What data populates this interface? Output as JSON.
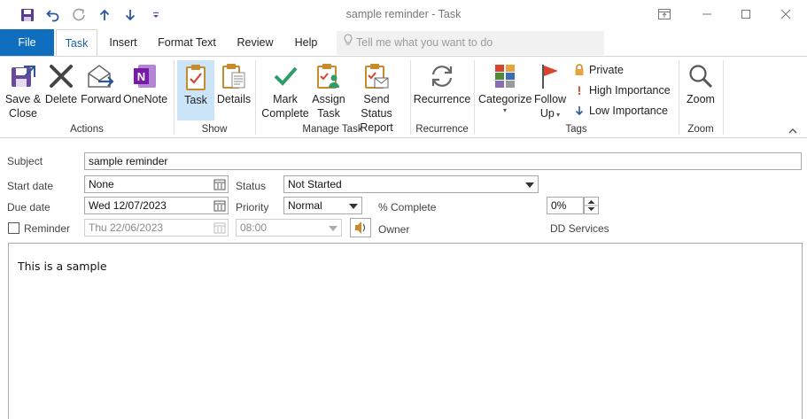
{
  "window": {
    "title": "sample reminder  -  Task"
  },
  "tabs": [
    {
      "label": "File"
    },
    {
      "label": "Task"
    },
    {
      "label": "Insert"
    },
    {
      "label": "Format Text"
    },
    {
      "label": "Review"
    },
    {
      "label": "Help"
    }
  ],
  "tellme": {
    "placeholder": "Tell me what you want to do"
  },
  "ribbon": {
    "actions": {
      "label": "Actions",
      "save_close": [
        "Save &",
        "Close"
      ],
      "delete": "Delete",
      "forward": "Forward",
      "onenote": "OneNote"
    },
    "show": {
      "label": "Show",
      "task": "Task",
      "details": "Details"
    },
    "manage": {
      "label": "Manage Task",
      "mark_complete": [
        "Mark",
        "Complete"
      ],
      "assign_task": [
        "Assign",
        "Task"
      ],
      "send_status": [
        "Send Status",
        "Report"
      ]
    },
    "recurrence": {
      "label": "Recurrence",
      "button": "Recurrence"
    },
    "tags": {
      "label": "Tags",
      "categorize": "Categorize",
      "follow_up": [
        "Follow",
        "Up"
      ],
      "private": "Private",
      "high": "High Importance",
      "low": "Low Importance"
    },
    "zoom": {
      "label": "Zoom",
      "button": "Zoom"
    }
  },
  "form": {
    "subject_label": "Subject",
    "subject_value": "sample reminder",
    "start_label": "Start date",
    "start_value": "None",
    "status_label": "Status",
    "status_value": "Not Started",
    "due_label": "Due date",
    "due_value": "Wed 12/07/2023",
    "priority_label": "Priority",
    "priority_value": "Normal",
    "complete_label": "% Complete",
    "complete_value": "0%",
    "reminder_label": "Reminder",
    "reminder_date": "Thu 22/06/2023",
    "reminder_time": "08:00",
    "owner_label": "Owner",
    "owner_value": "DD Services",
    "body_text": "This is a sample"
  },
  "colors": {
    "accent": "#106ebe",
    "selected": "#cce4f7",
    "onenote": "#7719aa",
    "mark_green": "#2f9d6a",
    "flag_red": "#d8452f"
  }
}
